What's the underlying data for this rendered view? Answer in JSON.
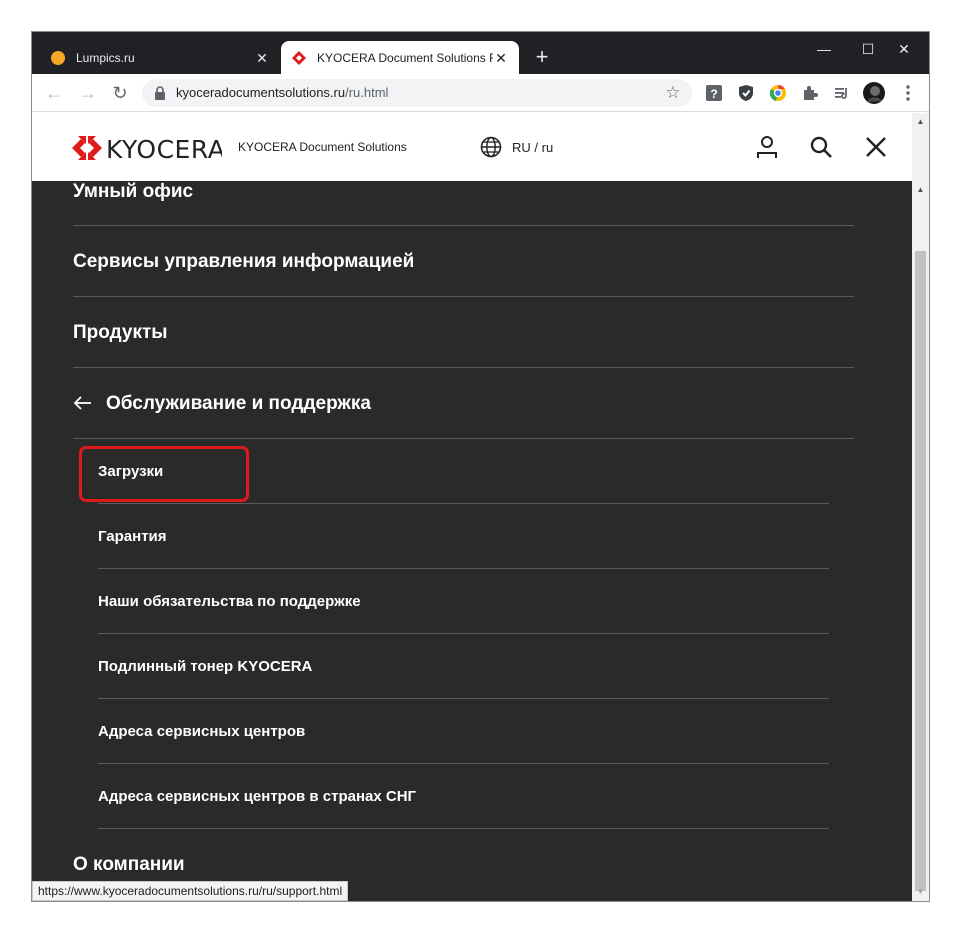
{
  "browser": {
    "tabs": [
      {
        "title": "Lumpics.ru",
        "favicon": "orange-circle-icon",
        "active": false
      },
      {
        "title": "KYOCERA Document Solutions R",
        "favicon": "kyocera-icon",
        "active": true
      }
    ],
    "new_tab_label": "+",
    "window_controls": {
      "minimize": "—",
      "maximize": "☐",
      "close": "✕"
    },
    "nav": {
      "back": "←",
      "forward": "→",
      "reload": "↻"
    },
    "url_host": "kyoceradocumentsolutions.ru",
    "url_path": "/ru.html",
    "star": "☆",
    "extensions": [
      "question-extension-icon",
      "shield-extension-icon",
      "chrome-extension-icon",
      "puzzle-icon",
      "media-queue-icon",
      "profile-avatar-icon",
      "menu-dots-icon"
    ]
  },
  "site": {
    "logo_text": "KYOCERA",
    "brand_sub": "KYOCERA Document Solutions",
    "lang": "RU / ru"
  },
  "menu": {
    "items": [
      {
        "label": "Умный офис"
      },
      {
        "label": "Сервисы управления информацией"
      },
      {
        "label": "Продукты"
      },
      {
        "label": "Обслуживание и поддержка"
      },
      {
        "label": "О компании"
      }
    ],
    "sub_items": [
      {
        "label": "Загрузки"
      },
      {
        "label": "Гарантия"
      },
      {
        "label": "Наши обязательства по поддержке"
      },
      {
        "label": "Подлинный тонер KYOCERA"
      },
      {
        "label": "Адреса сервисных центров"
      },
      {
        "label": "Адреса сервисных центров в странах СНГ"
      }
    ]
  },
  "status_url": "https://www.kyoceradocumentsolutions.ru/ru/support.html",
  "colors": {
    "accent_red": "#e0191b",
    "menu_bg": "#2a2a2a",
    "tabstrip_bg": "#202124"
  }
}
